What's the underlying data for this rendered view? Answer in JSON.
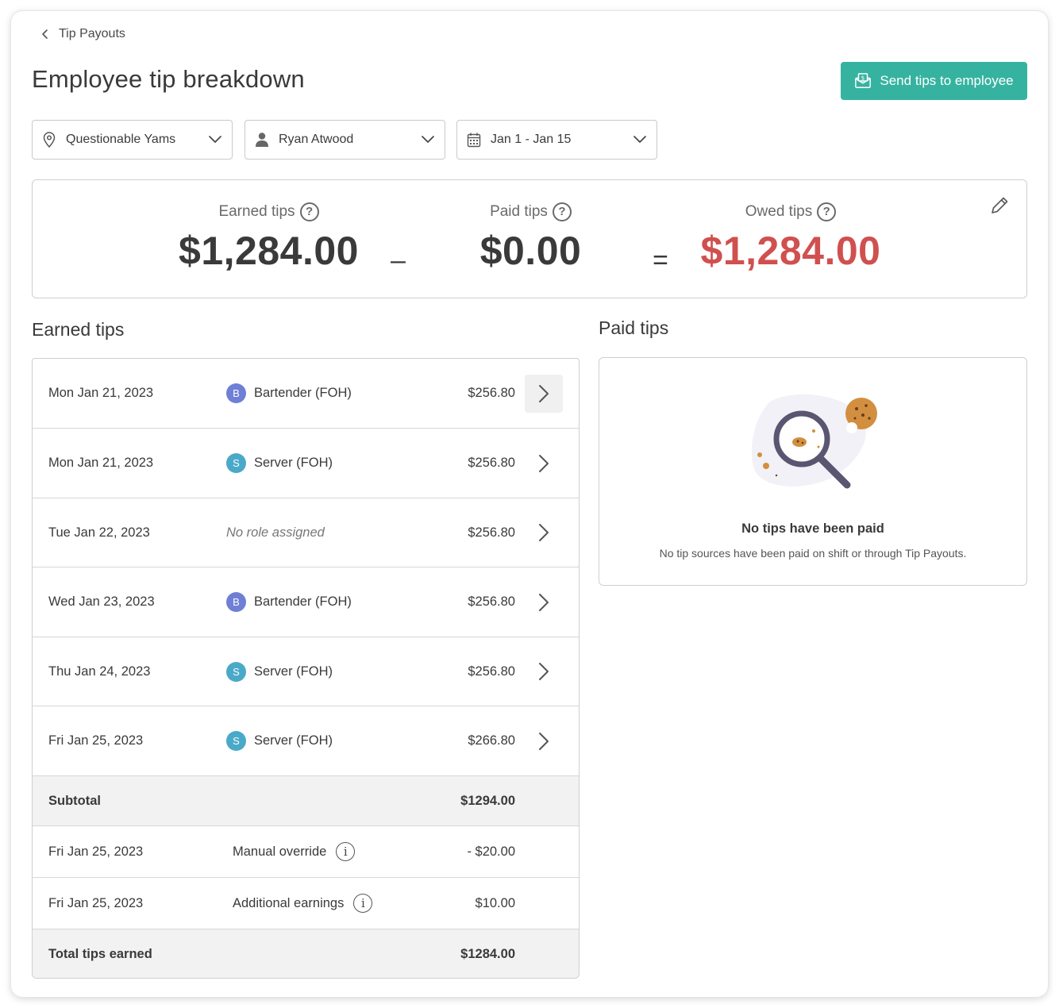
{
  "breadcrumb": {
    "back_label": "Tip Payouts"
  },
  "page": {
    "title": "Employee tip breakdown"
  },
  "actions": {
    "send_tips_label": "Send tips to employee"
  },
  "filters": {
    "location": "Questionable Yams",
    "employee": "Ryan Atwood",
    "date_range": "Jan 1 - Jan 15"
  },
  "summary": {
    "earned_label": "Earned tips",
    "earned_value": "$1,284.00",
    "minus": "–",
    "paid_label": "Paid tips",
    "paid_value": "$0.00",
    "equals": "=",
    "owed_label": "Owed tips",
    "owed_value": "$1,284.00",
    "help_glyph": "?"
  },
  "earned": {
    "title": "Earned tips",
    "rows": [
      {
        "date": "Mon Jan 21, 2023",
        "role_initial": "B",
        "role": "Bartender (FOH)",
        "amount": "$256.80"
      },
      {
        "date": "Mon Jan 21, 2023",
        "role_initial": "S",
        "role": "Server (FOH)",
        "amount": "$256.80"
      },
      {
        "date": "Tue Jan 22, 2023",
        "role_initial": "",
        "role": "No role assigned",
        "amount": "$256.80"
      },
      {
        "date": "Wed Jan 23, 2023",
        "role_initial": "B",
        "role": "Bartender (FOH)",
        "amount": "$256.80"
      },
      {
        "date": "Thu Jan 24, 2023",
        "role_initial": "S",
        "role": "Server (FOH)",
        "amount": "$256.80"
      },
      {
        "date": "Fri Jan 25, 2023",
        "role_initial": "S",
        "role": "Server (FOH)",
        "amount": "$266.80"
      }
    ],
    "subtotal_label": "Subtotal",
    "subtotal_value": "$1294.00",
    "adjustments": [
      {
        "date": "Fri Jan 25, 2023",
        "label": "Manual override",
        "amount": "- $20.00"
      },
      {
        "date": "Fri Jan 25, 2023",
        "label": "Additional earnings",
        "amount": "$10.00"
      }
    ],
    "info_glyph": "i",
    "total_label": "Total tips earned",
    "total_value": "$1284.00"
  },
  "paid": {
    "title": "Paid tips",
    "empty_title": "No tips have been paid",
    "empty_subtitle": "No tip sources have been paid on shift or through Tip Payouts."
  },
  "colors": {
    "accent": "#36b3a0",
    "owed": "#d0504f",
    "bartender_badge": "#6f7fd6",
    "server_badge": "#4aa9c9"
  },
  "icons": [
    "chevron-left-icon",
    "money-envelope-icon",
    "location-pin-icon",
    "person-icon",
    "calendar-icon",
    "chevron-down-icon",
    "help-icon",
    "pencil-icon",
    "chevron-right-icon",
    "info-icon",
    "magnifier-cookie-illustration"
  ]
}
